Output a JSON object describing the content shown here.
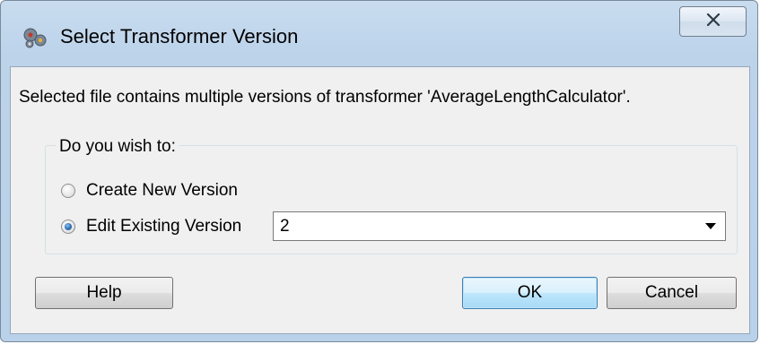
{
  "window": {
    "title": "Select Transformer Version"
  },
  "icons": {
    "app_icon": "gear-cluster-icon",
    "close_icon": "close-icon"
  },
  "message": "Selected file contains multiple versions of transformer 'AverageLengthCalculator'.",
  "group": {
    "legend": "Do you wish to:",
    "options": [
      {
        "label": "Create New Version",
        "checked": false
      },
      {
        "label": "Edit Existing Version",
        "checked": true
      }
    ],
    "version_select": {
      "value": "2"
    }
  },
  "buttons": {
    "help": "Help",
    "ok": "OK",
    "cancel": "Cancel"
  },
  "colors": {
    "frame": "#bcd3ea",
    "client": "#f0f0f0",
    "default_button_border": "#3c7fb1"
  }
}
